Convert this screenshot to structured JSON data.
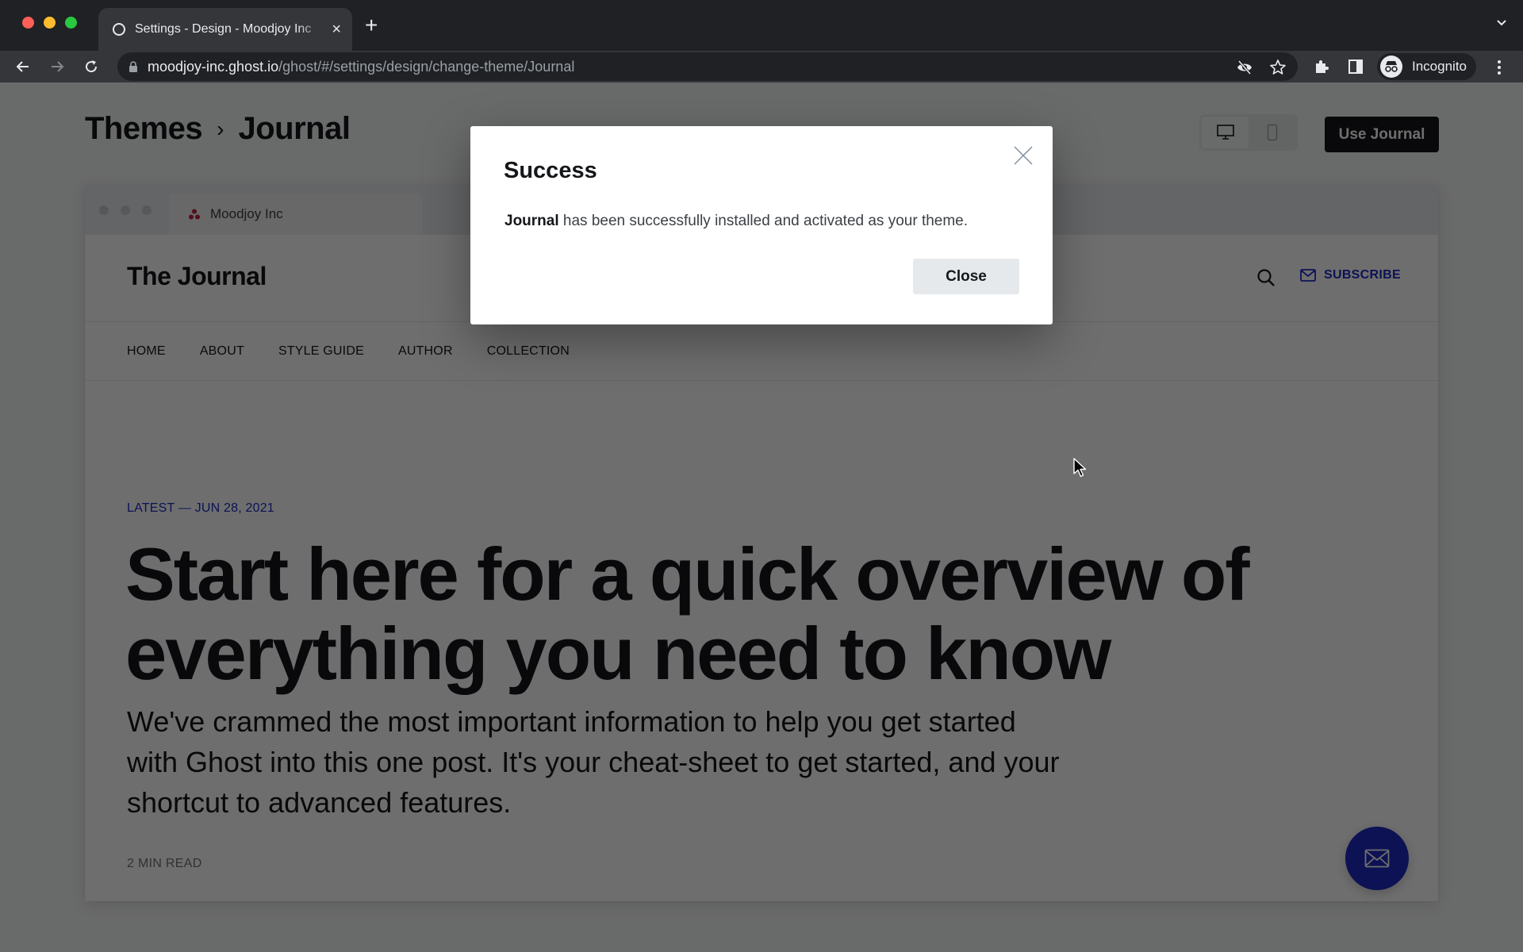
{
  "browser": {
    "tab_title": "Settings - Design - Moodjoy Inc",
    "tab_close": "×",
    "new_tab": "+",
    "url_host": "moodjoy-inc.ghost.io",
    "url_path": "/ghost/#/settings/design/change-theme/Journal",
    "profile_label": "Incognito",
    "icons": [
      "back-icon",
      "forward-icon",
      "reload-icon",
      "lock-icon",
      "eye-off-icon",
      "star-icon",
      "extensions-icon",
      "side-panel-icon",
      "incognito-icon",
      "more-icon",
      "tab-list-chevron-icon"
    ]
  },
  "header": {
    "breadcrumb": [
      "Themes",
      "Journal"
    ],
    "separator": "›",
    "use_button": "Use Journal",
    "device_modes": [
      "desktop",
      "mobile"
    ],
    "active_device": "desktop"
  },
  "preview": {
    "tab_title": "Moodjoy Inc",
    "site_title": "The Journal",
    "subscribe_label": "SUBSCRIBE",
    "nav": [
      "HOME",
      "ABOUT",
      "STYLE GUIDE",
      "AUTHOR",
      "COLLECTION"
    ],
    "post": {
      "meta": "LATEST — JUN 28, 2021",
      "title": "Start here for a quick overview of everything you need to know",
      "excerpt": "We've crammed the most important information to help you get started with Ghost into this one post. It's your cheat-sheet to get started, and your shortcut to advanced features.",
      "read_time": "2 MIN READ"
    },
    "accent_color": "#1d2bc4"
  },
  "modal": {
    "title": "Success",
    "body_bold": "Journal",
    "body_rest": " has been successfully installed and activated as your theme.",
    "close_button": "Close"
  }
}
